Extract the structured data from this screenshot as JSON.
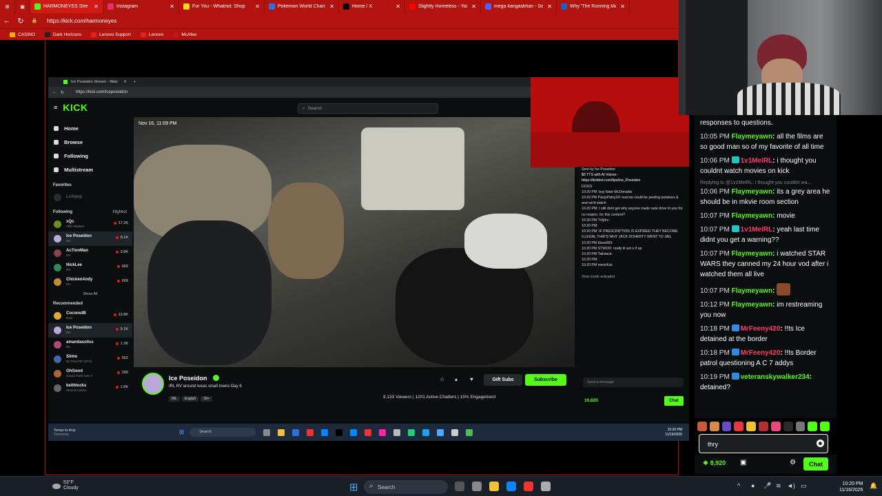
{
  "browser": {
    "tabs": [
      {
        "label": "HARMONEYES Stre",
        "color": "#53fc18",
        "active": true
      },
      {
        "label": "Instagram",
        "color": "#e1306c"
      },
      {
        "label": "For You - Whatnot: Shop",
        "color": "#f5d90a"
      },
      {
        "label": "Pokemon World Champi",
        "color": "#2f6fe0"
      },
      {
        "label": "Home / X",
        "color": "#000000"
      },
      {
        "label": "Slightly Homeless - YouT",
        "color": "#ff0000"
      },
      {
        "label": "mega kangaskhan - Sea",
        "color": "#4a63ff"
      },
      {
        "label": "Why 'The Running Man'",
        "color": "#1565c0"
      }
    ],
    "url": "https://kick.com/harmoneyes",
    "bookmarks": [
      "CASINO",
      "Dark Horizons",
      "Lenovo Support",
      "Lenovo",
      "McAfee"
    ]
  },
  "inner": {
    "tab_title": "Ice Poseidon Stream - Watc",
    "url": "https://kick.com/iceposeidon",
    "logo": "KICK",
    "search_placeholder": "Search",
    "nav": [
      "Home",
      "Browse",
      "Following",
      "Multistream"
    ],
    "favorites_label": "Favorites",
    "favorites_item": "Lollipop",
    "following_label": "Following",
    "sort_label": "Highest",
    "following": [
      {
        "name": "xQc",
        "sub": "ARC Raiders",
        "viewers": "17.2K"
      },
      {
        "name": "Ice Poseidon",
        "sub": "IRL",
        "viewers": "9.1K"
      },
      {
        "name": "Ac7ionMan",
        "sub": "IRL",
        "viewers": "3.8K"
      },
      {
        "name": "NickLee",
        "sub": "IRL",
        "viewers": "662"
      },
      {
        "name": "ChickenAndy",
        "sub": "IRL",
        "viewers": "609"
      }
    ],
    "show_all": "Show All",
    "recommended_label": "Recommended",
    "recommended": [
      {
        "name": "CoconutB",
        "sub": "Rust",
        "viewers": "13.8K"
      },
      {
        "name": "Ice Poseidon",
        "sub": "IRL",
        "viewers": "9.1K"
      },
      {
        "name": "amandasoliss",
        "sub": "IRL",
        "viewers": "1.3K"
      },
      {
        "name": "Slimo",
        "sub": "No Pixel RP (GTA)",
        "viewers": "552"
      },
      {
        "name": "OhGood",
        "sub": "Grand Theft Auto V",
        "viewers": "200"
      },
      {
        "name": "keithlocks",
        "sub": "Slots & Casino",
        "viewers": "1.6K"
      }
    ],
    "video_date": "Nov 16, 11:09 PM",
    "streamer": "Ice Poseidon",
    "stream_title": "IRL RV around texas small towns Day 6",
    "tags": [
      "IRL",
      "English",
      "18+"
    ],
    "stats": "9,133 Viewers | 1201 Active Chatters | 15% Engagement",
    "gift_subs": "Gift Subs",
    "subscribe": "Subscribe",
    "chat_lines": [
      "Sent by Ice Poseidon",
      "$5 TTS with AI Voices -",
      "https://kickbot.com/tips/Ice_Poseidon",
      "DOGS",
      "10:20 PM: buy Nate McDonalds",
      "10:20 PM PastyPatsy24: real ice could be peeling potatoes & and we'd watch",
      "10:20 PM: I still dont get why anyone made nate drive to you for no reason. for this content?",
      "10:20 PM 7r0j4rc:",
      "10:20 PM:",
      "10:20 PM: IF PRESCRIPTION IS EXPIRED THEY BECOME ILLEGAL THATS WHY JACK DOHERTY WENT TO JAIL",
      "10:20 PM Ebes069:",
      "10:20 PM STWOO: really ill set u if up",
      "10:20 PM Tailstack:",
      "10:20 PM:",
      "10:20 PM mericKat:"
    ],
    "slow_mode": "Slow mode activated",
    "send_placeholder": "Send a message",
    "points": "10,820",
    "chat_button": "Chat",
    "taskbar_left": "Temps to drop",
    "taskbar_left_sub": "Tomorrow",
    "taskbar_search": "Search",
    "taskbar_time": "10:20 PM",
    "taskbar_date": "11/16/2025"
  },
  "chat": {
    "messages": [
      {
        "time": "",
        "user": "",
        "user_color": "#ffffff",
        "text": "responses to questions."
      },
      {
        "time": "10:05 PM",
        "user": "Flaymeyawn",
        "user_color": "#53fc18",
        "text": "all the films are so good man so of my favorite of all time"
      },
      {
        "time": "10:06 PM",
        "user": "1v1MeIRL",
        "user_color": "#ff3a6e",
        "badge": "#22c3c3",
        "text": "i thought you couldnt watch movies on kick"
      },
      {
        "reply": "Replying to @1v1MeIRL: i thought you couldnt wa..."
      },
      {
        "time": "10:06 PM",
        "user": "Flaymeyawn",
        "user_color": "#53fc18",
        "text": "its a grey area he should be in mkvie room section"
      },
      {
        "time": "10:07 PM",
        "user": "Flaymeyawn",
        "user_color": "#53fc18",
        "text": "movie"
      },
      {
        "time": "10:07 PM",
        "user": "1v1MeIRL",
        "user_color": "#ff3a6e",
        "badge": "#22c3c3",
        "text": "yeah last time didnt you get a warning??"
      },
      {
        "time": "10:07 PM",
        "user": "Flaymeyawn",
        "user_color": "#53fc18",
        "text": "i watched STAR WARS they canned my 24 hour vod after i watched them all live"
      },
      {
        "time": "10:07 PM",
        "user": "Flaymeyawn",
        "user_color": "#53fc18",
        "text": "",
        "emote": true
      },
      {
        "time": "10:12 PM",
        "user": "Flaymeyawn",
        "user_color": "#53fc18",
        "text": "im restreaming you now"
      },
      {
        "time": "10:18 PM",
        "user": "MrFeeny420",
        "user_color": "#ff3a6e",
        "badge": "#2f8be6",
        "text": "!!ts Ice detained at the border"
      },
      {
        "time": "10:18 PM",
        "user": "MrFeeny420",
        "user_color": "#ff3a6e",
        "badge": "#2f8be6",
        "text": "!!ts Border patrol questioning A C 7 addys"
      },
      {
        "time": "10:19 PM",
        "user": "veteranskywalker234",
        "user_color": "#53fc18",
        "badge": "#2f8be6",
        "text": "detained?"
      }
    ],
    "input_value": "thry",
    "points": "8,920",
    "chat_button": "Chat"
  },
  "taskbar": {
    "temp": "53°F",
    "weather": "Cloudy",
    "search": "Search",
    "time": "10:20 PM",
    "date": "11/16/2025"
  },
  "colors": {
    "kick_green": "#53fc18",
    "browser_red": "#b3130f"
  }
}
